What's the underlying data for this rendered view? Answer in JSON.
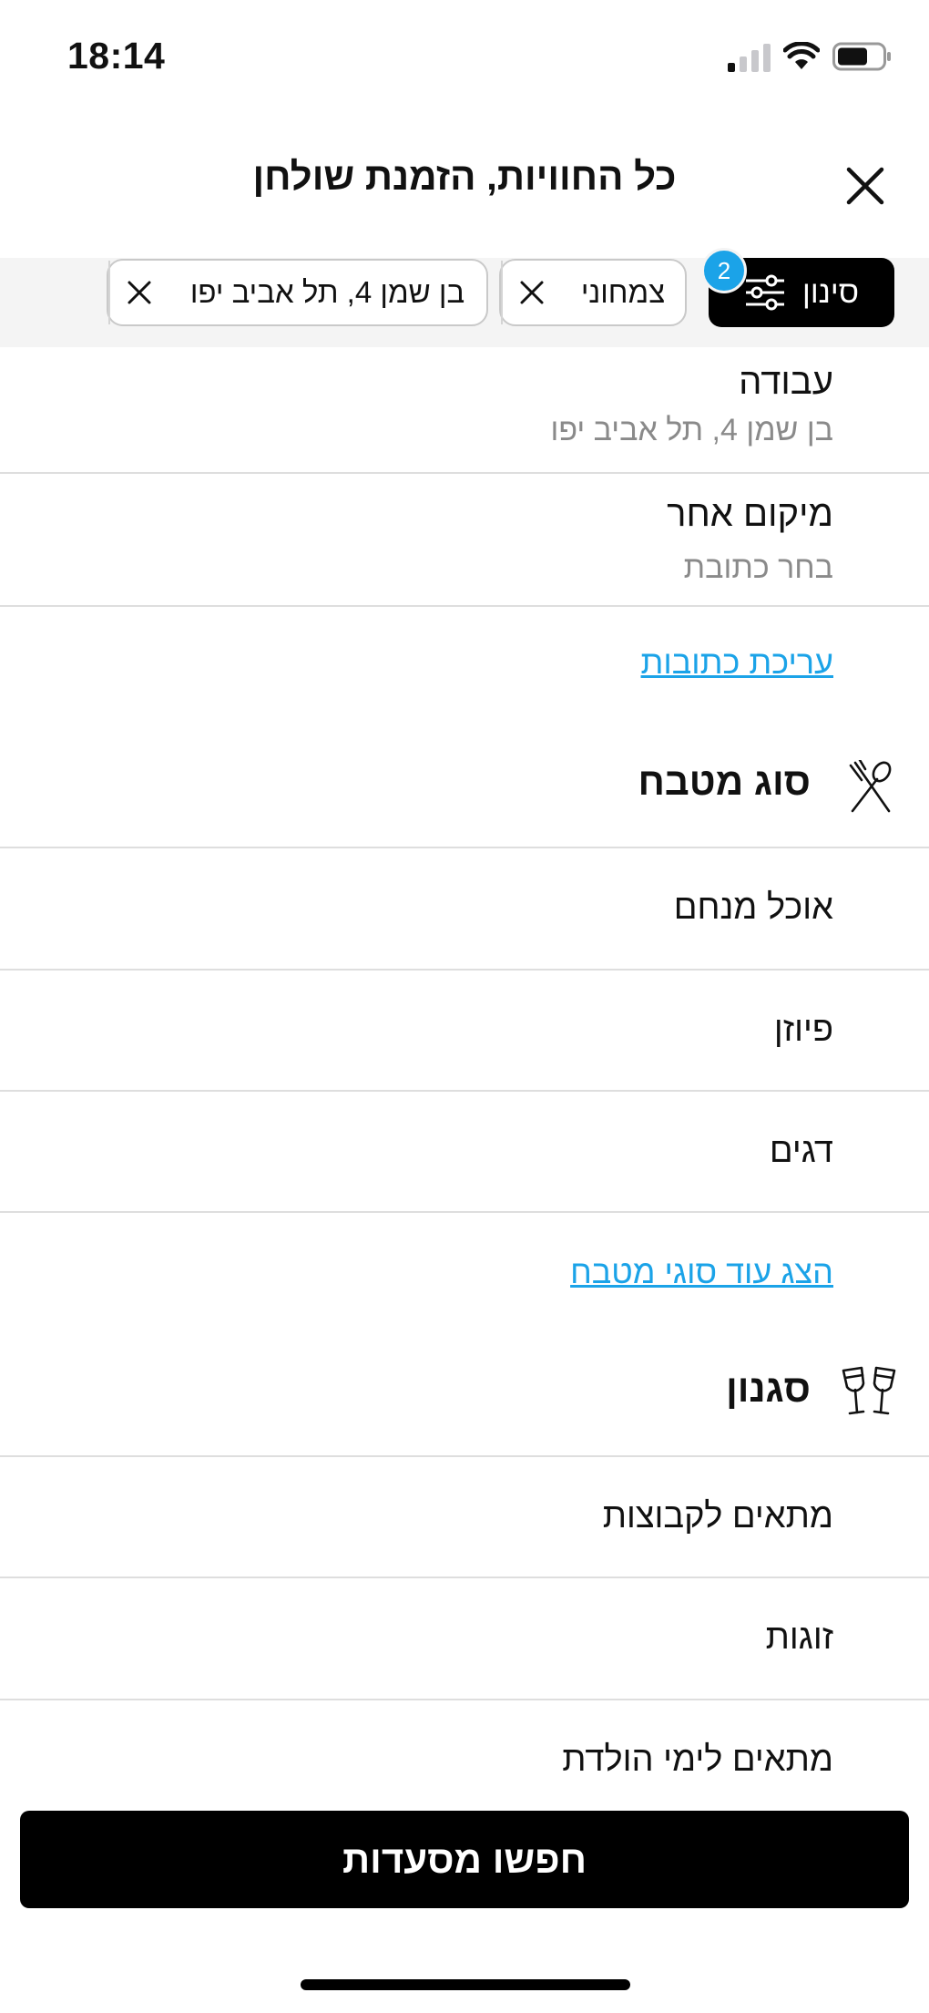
{
  "status_bar": {
    "time": "18:14"
  },
  "header": {
    "title": "כל החוויות, הזמנת שולחן"
  },
  "filters": {
    "filter_label": "סינון",
    "badge_count": "2",
    "chips": [
      {
        "label": "צמחוני"
      },
      {
        "label": "בן שמן 4, תל אביב יפו"
      }
    ]
  },
  "location": {
    "items": [
      {
        "title": "עבודה",
        "subtitle": "בן שמן 4, תל אביב יפו"
      },
      {
        "title": "מיקום אחר",
        "subtitle": "בחר כתובת"
      }
    ],
    "edit_link": "עריכת כתובות"
  },
  "cuisine": {
    "title": "סוג מטבח",
    "icon": "fork-spoon-icon",
    "items": [
      "אוכל מנחם",
      "פיוזן",
      "דגים"
    ],
    "more_link": "הצג עוד סוגי מטבח"
  },
  "style": {
    "title": "סגנון",
    "icon": "wine-glasses-icon",
    "items": [
      "מתאים לקבוצות",
      "זוגות",
      "מתאים לימי הולדת"
    ]
  },
  "cta": {
    "label": "חפשו מסעדות"
  },
  "colors": {
    "accent": "#1ba3e8",
    "primary": "#000000",
    "divider": "#dedede"
  }
}
